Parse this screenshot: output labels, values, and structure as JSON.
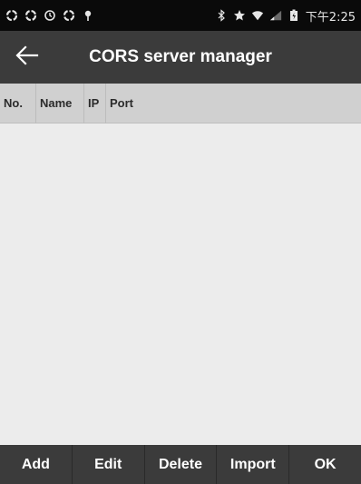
{
  "status_bar": {
    "left_icons": [
      "sync-icon",
      "sync-icon",
      "timer-icon",
      "sync-icon",
      "location-pin-icon"
    ],
    "right_icons": [
      "bluetooth-icon",
      "star-icon",
      "wifi-icon",
      "signal-icon",
      "battery-icon"
    ],
    "time": "下午2:25"
  },
  "app_bar": {
    "title": "CORS server manager",
    "back_icon": "arrow-left-icon"
  },
  "table": {
    "columns": [
      "No.",
      "Name",
      "IP",
      "Port"
    ],
    "rows": []
  },
  "bottom_bar": {
    "buttons": [
      "Add",
      "Edit",
      "Delete",
      "Import",
      "OK"
    ]
  },
  "colors": {
    "status_bar_bg": "#0a0a0a",
    "app_bar_bg": "#3b3b3b",
    "header_bg": "#d0d0d0",
    "body_bg": "#ececec"
  }
}
